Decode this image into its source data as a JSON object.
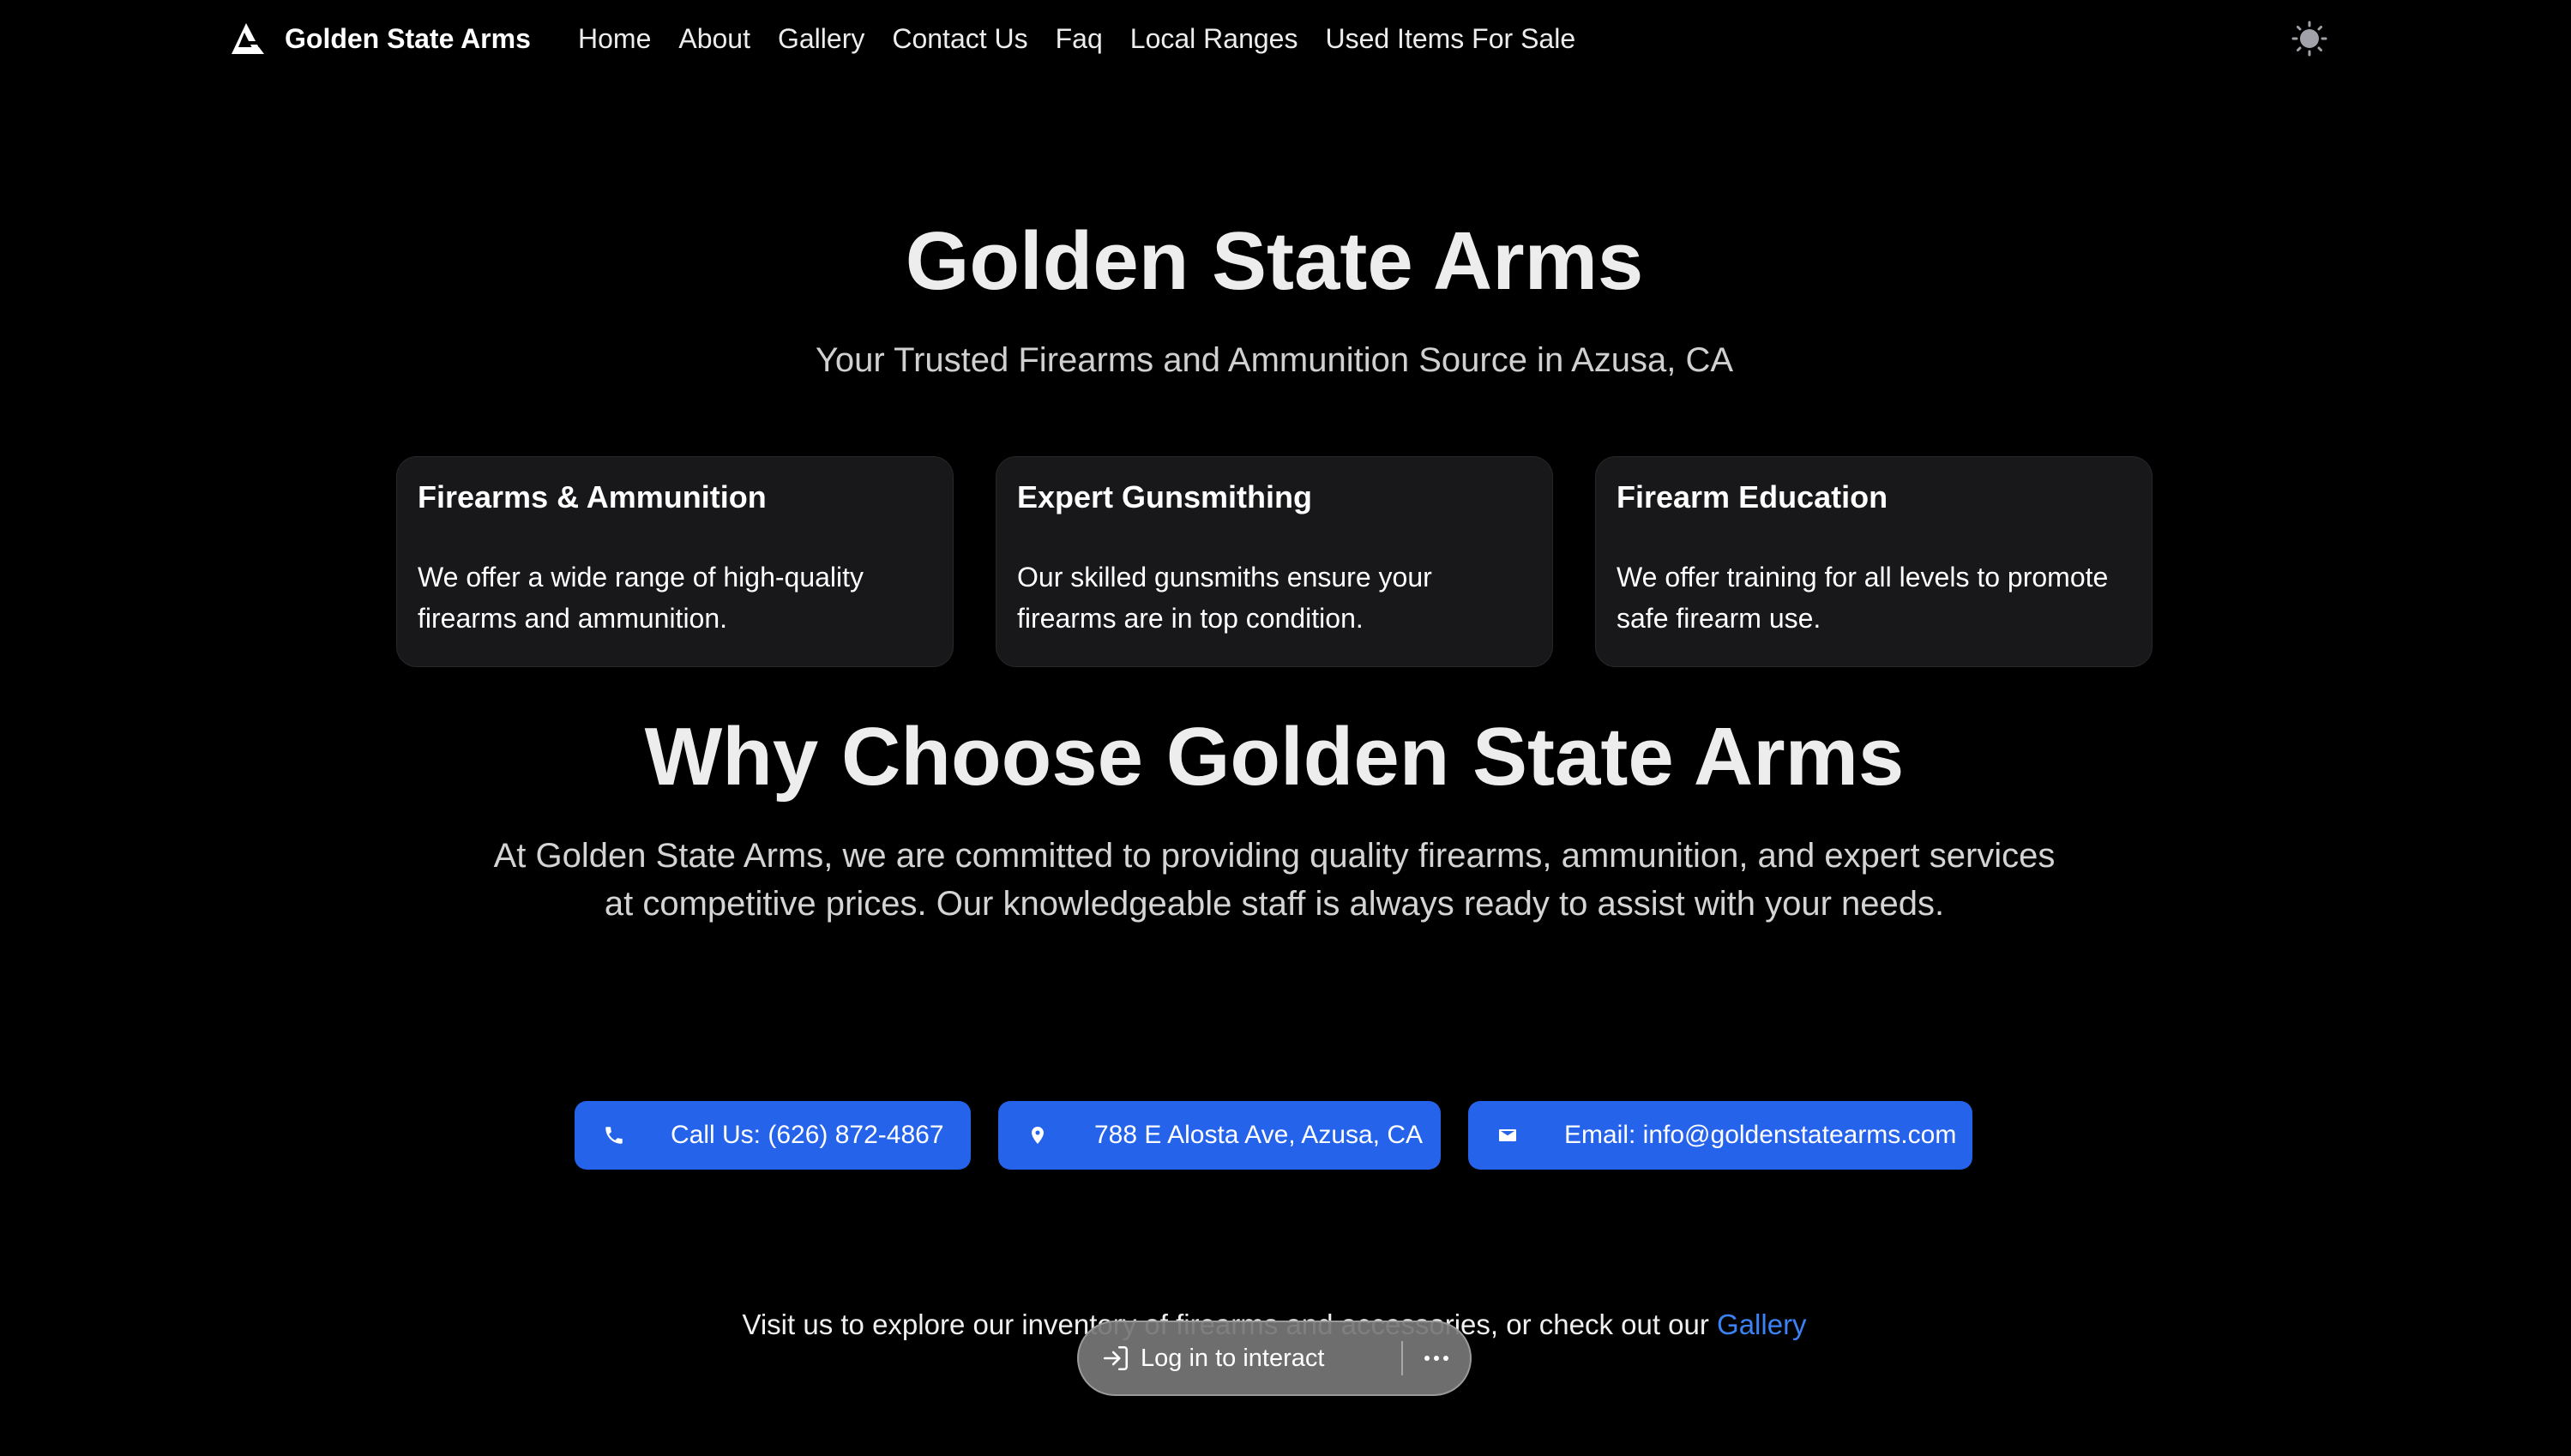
{
  "nav": {
    "brand": "Golden State Arms",
    "links": [
      "Home",
      "About",
      "Gallery",
      "Contact Us",
      "Faq",
      "Local Ranges",
      "Used Items For Sale"
    ]
  },
  "hero": {
    "title": "Golden State Arms",
    "subtitle": "Your Trusted Firearms and Ammunition Source in Azusa, CA"
  },
  "features": [
    {
      "title": "Firearms & Ammunition",
      "text": "We offer a wide range of high-quality firearms and ammunition."
    },
    {
      "title": "Expert Gunsmithing",
      "text": "Our skilled gunsmiths ensure your firearms are in top condition."
    },
    {
      "title": "Firearm Education",
      "text": "We offer training for all levels to promote safe firearm use."
    }
  ],
  "why": {
    "title": "Why Choose Golden State Arms",
    "text": "At Golden State Arms, we are committed to providing quality firearms, ammunition, and expert services at competitive prices. Our knowledgeable staff is always ready to assist with your needs."
  },
  "contact": {
    "phone": "Call Us: (626) 872-4867",
    "address": "788 E Alosta Ave, Azusa, CA",
    "email": "Email: info@goldenstatearms.com"
  },
  "footer": {
    "visit_prefix": "Visit us to explore our inventory of firearms and accessories, or check out our ",
    "gallery_link": "Gallery"
  },
  "overlay": {
    "login_label": "Log in to interact"
  },
  "icons": {
    "logo": "triangle-logo-icon",
    "theme": "sun-icon",
    "phone": "phone-icon",
    "address": "map-pin-icon",
    "email": "mail-icon",
    "login": "login-icon",
    "more": "more-icon"
  },
  "colors": {
    "background": "#000000",
    "card": "#18181b",
    "accent": "#2563eb",
    "link": "#3b82f6"
  }
}
